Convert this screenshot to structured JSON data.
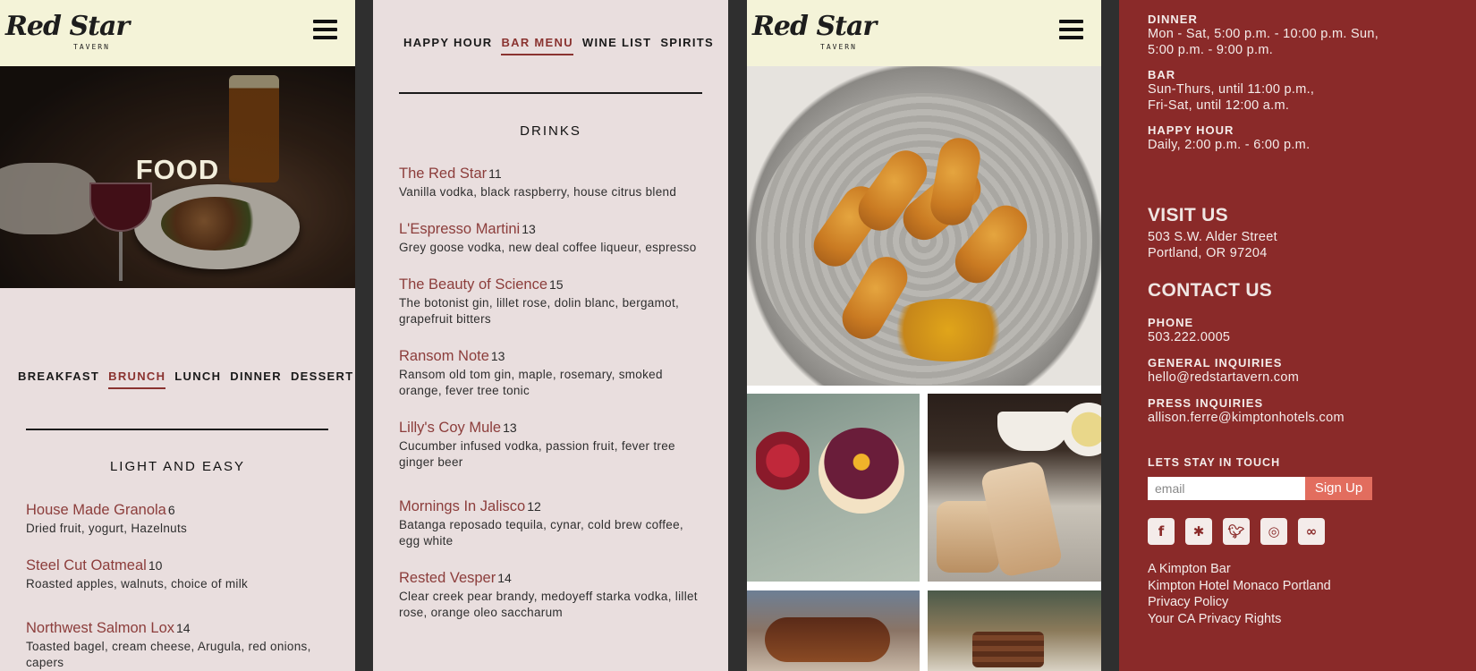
{
  "logo": {
    "script": "Red Star",
    "sub": "TAVERN"
  },
  "food_panel": {
    "hero_title": "FOOD",
    "tabs": [
      "BREAKFAST",
      "BRUNCH",
      "LUNCH",
      "DINNER",
      "DESSERT"
    ],
    "active_tab": "BRUNCH",
    "section_title": "LIGHT AND EASY",
    "items": [
      {
        "name": "House Made Granola",
        "price": "6",
        "desc": "Dried fruit, yogurt, Hazelnuts"
      },
      {
        "name": "Steel Cut Oatmeal",
        "price": "10",
        "desc": "Roasted apples, walnuts, choice of milk"
      },
      {
        "name": "Northwest Salmon Lox",
        "price": "14",
        "desc": "Toasted bagel, cream cheese, Arugula, red onions, capers"
      }
    ]
  },
  "bar_panel": {
    "tabs": [
      "HAPPY HOUR",
      "BAR MENU",
      "WINE LIST",
      "SPIRITS"
    ],
    "active_tab": "BAR MENU",
    "section_title": "DRINKS",
    "items": [
      {
        "name": "The Red Star",
        "price": "11",
        "desc": "Vanilla vodka, black raspberry, house citrus blend"
      },
      {
        "name": "L'Espresso Martini",
        "price": "13",
        "desc": "Grey goose vodka, new deal coffee liqueur, espresso"
      },
      {
        "name": "The Beauty of Science",
        "price": "15",
        "desc": "The botonist gin, lillet rose, dolin blanc, bergamot, grapefruit bitters"
      },
      {
        "name": "Ransom Note",
        "price": "13",
        "desc": "Ransom old tom gin, maple, rosemary, smoked orange, fever tree tonic"
      },
      {
        "name": "Lilly's Coy Mule",
        "price": "13",
        "desc": "Cucumber infused vodka, passion fruit, fever tree ginger beer"
      },
      {
        "name": "Mornings In Jalisco",
        "price": "12",
        "desc": "Batanga reposado tequila, cynar, cold brew coffee, egg white"
      },
      {
        "name": "Rested Vesper",
        "price": "14",
        "desc": "Clear creek pear brandy, medoyeff starka vodka, lillet rose, orange oleo saccharum"
      }
    ]
  },
  "info_panel": {
    "hours": [
      {
        "label": "DINNER",
        "text": "Mon - Sat, 5:00 p.m. - 10:00 p.m. Sun, 5:00 p.m. - 9:00 p.m."
      },
      {
        "label": "BAR",
        "text": "Sun-Thurs, until 11:00 p.m., Fri-Sat, until 12:00 a.m."
      },
      {
        "label": "HAPPY HOUR",
        "text": "Daily, 2:00 p.m. - 6:00 p.m."
      }
    ],
    "visit_title": "VISIT US",
    "address_line1": "503 S.W. Alder Street",
    "address_line2": "Portland, OR 97204",
    "contact_title": "CONTACT US",
    "contacts": [
      {
        "label": "PHONE",
        "text": "503.222.0005"
      },
      {
        "label": "GENERAL INQUIRIES",
        "text": "hello@redstartavern.com"
      },
      {
        "label": "PRESS INQUIRIES",
        "text": "allison.ferre@kimptonhotels.com"
      }
    ],
    "newsletter_title": "LETS STAY IN TOUCH",
    "email_placeholder": "email",
    "signup_label": "Sign Up",
    "socials": [
      "facebook-icon",
      "yelp-icon",
      "twitter-icon",
      "instagram-icon",
      "tripadvisor-icon"
    ],
    "footer_links": [
      "A Kimpton Bar",
      "Kimpton Hotel Monaco Portland",
      "Privacy Policy",
      "Your CA Privacy Rights"
    ]
  },
  "colors": {
    "accent": "#8c3d3b",
    "panel_bg": "#e9dede",
    "header_bg": "#f4f3d8",
    "info_bg": "#8a2a29",
    "button": "#e26d5e"
  }
}
